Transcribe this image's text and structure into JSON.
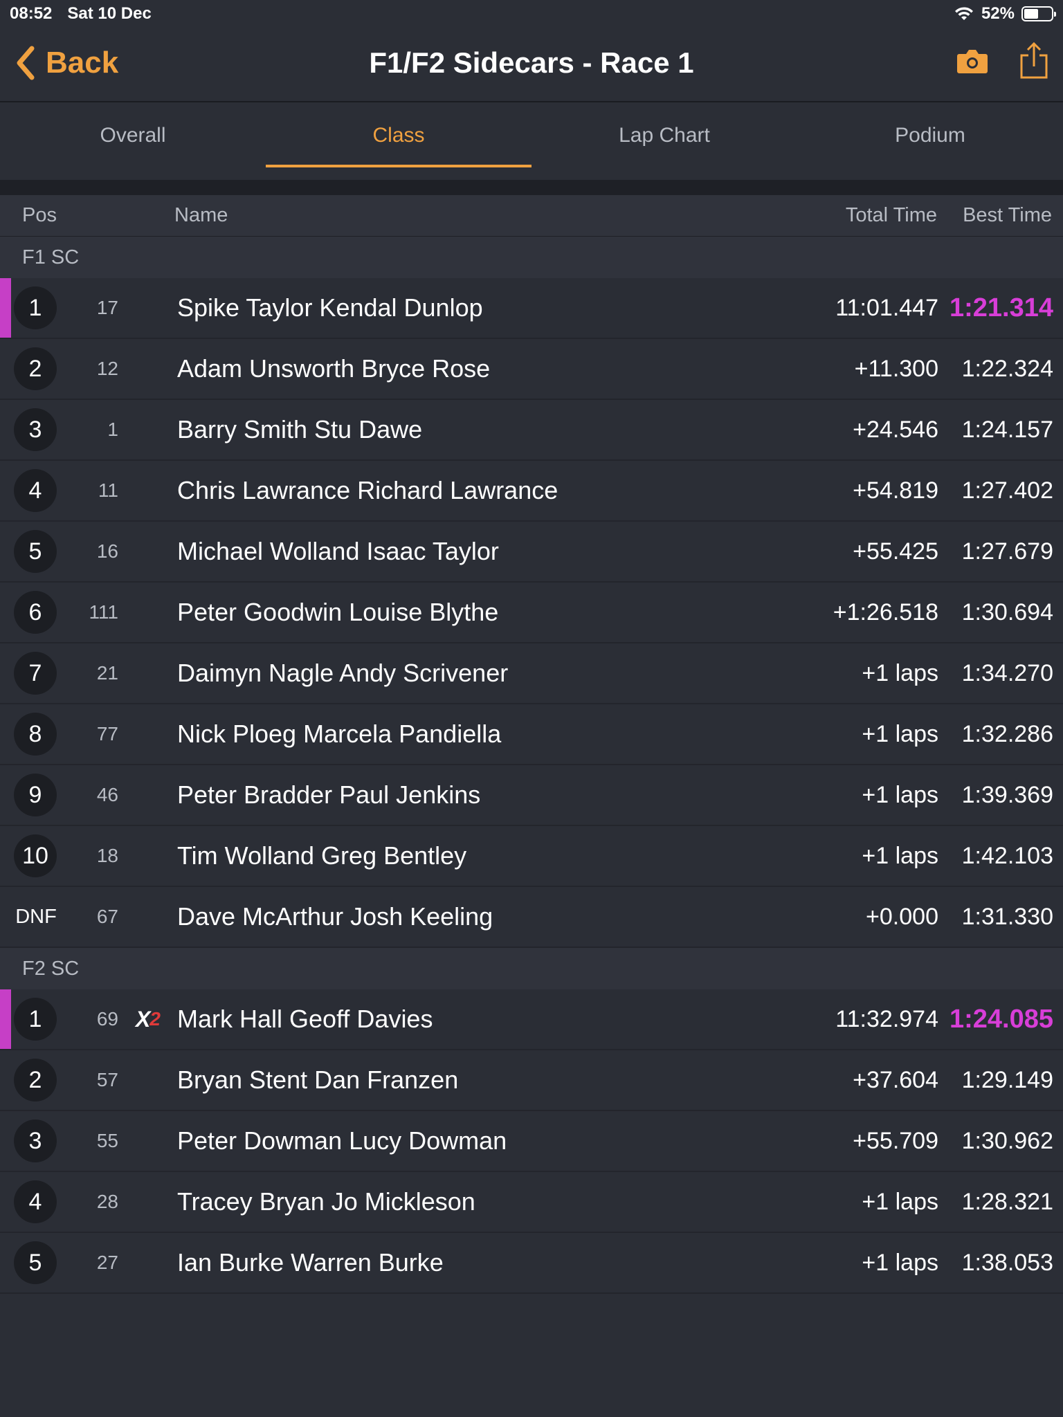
{
  "status_bar": {
    "time": "08:52",
    "date": "Sat 10 Dec",
    "battery": "52%",
    "battery_level": 0.52
  },
  "nav": {
    "back_label": "Back",
    "title": "F1/F2 Sidecars - Race 1"
  },
  "tabs": [
    {
      "label": "Overall",
      "active": false
    },
    {
      "label": "Class",
      "active": true
    },
    {
      "label": "Lap Chart",
      "active": false
    },
    {
      "label": "Podium",
      "active": false
    }
  ],
  "table": {
    "headers": {
      "pos": "Pos",
      "name": "Name",
      "total": "Total Time",
      "best": "Best Time"
    },
    "groups": [
      {
        "name": "F1 SC",
        "rows": [
          {
            "pos": "1",
            "num": "17",
            "name": "Spike Taylor Kendal Dunlop",
            "total": "11:01.447",
            "best": "1:21.314"
          },
          {
            "pos": "2",
            "num": "12",
            "name": "Adam Unsworth Bryce Rose",
            "total": "+11.300",
            "best": "1:22.324"
          },
          {
            "pos": "3",
            "num": "1",
            "name": "Barry Smith Stu Dawe",
            "total": "+24.546",
            "best": "1:24.157"
          },
          {
            "pos": "4",
            "num": "11",
            "name": "Chris Lawrance Richard Lawrance",
            "total": "+54.819",
            "best": "1:27.402"
          },
          {
            "pos": "5",
            "num": "16",
            "name": "Michael Wolland Isaac Taylor",
            "total": "+55.425",
            "best": "1:27.679"
          },
          {
            "pos": "6",
            "num": "111",
            "name": "Peter Goodwin Louise Blythe",
            "total": "+1:26.518",
            "best": "1:30.694"
          },
          {
            "pos": "7",
            "num": "21",
            "name": "Daimyn Nagle Andy Scrivener",
            "total": "+1 laps",
            "best": "1:34.270"
          },
          {
            "pos": "8",
            "num": "77",
            "name": "Nick Ploeg Marcela Pandiella",
            "total": "+1 laps",
            "best": "1:32.286"
          },
          {
            "pos": "9",
            "num": "46",
            "name": "Peter Bradder Paul Jenkins",
            "total": "+1 laps",
            "best": "1:39.369"
          },
          {
            "pos": "10",
            "num": "18",
            "name": "Tim Wolland Greg Bentley",
            "total": "+1 laps",
            "best": "1:42.103"
          },
          {
            "pos": "DNF",
            "num": "67",
            "name": "Dave McArthur Josh Keeling",
            "total": "+0.000",
            "best": "1:31.330"
          }
        ]
      },
      {
        "name": "F2 SC",
        "rows": [
          {
            "pos": "1",
            "num": "69",
            "badge": {
              "x": "X",
              "n": "2"
            },
            "name": "Mark Hall Geoff Davies",
            "total": "11:32.974",
            "best": "1:24.085"
          },
          {
            "pos": "2",
            "num": "57",
            "name": "Bryan Stent Dan Franzen",
            "total": "+37.604",
            "best": "1:29.149"
          },
          {
            "pos": "3",
            "num": "55",
            "name": "Peter Dowman Lucy Dowman",
            "total": "+55.709",
            "best": "1:30.962"
          },
          {
            "pos": "4",
            "num": "28",
            "name": "Tracey Bryan Jo Mickleson",
            "total": "+1 laps",
            "best": "1:28.321"
          },
          {
            "pos": "5",
            "num": "27",
            "name": "Ian Burke Warren Burke",
            "total": "+1 laps",
            "best": "1:38.053"
          }
        ]
      }
    ]
  },
  "colors": {
    "accent": "#f0a140",
    "fastest": "#d83ed8",
    "leader_bar": "#c63fc6",
    "background": "#2b2e36"
  },
  "icons": {
    "back": "chevron-left-icon",
    "camera": "camera-icon",
    "share": "share-icon",
    "wifi": "wifi-icon",
    "battery": "battery-icon"
  }
}
